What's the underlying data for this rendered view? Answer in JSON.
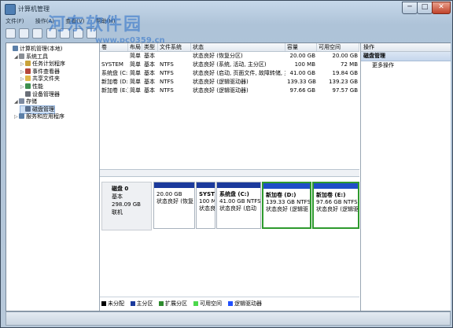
{
  "window": {
    "title": "计算机管理",
    "watermark": "河东软件园",
    "watermark_url": "www.pc0359.cn",
    "minimize": "─",
    "maximize": "□",
    "close": "✕"
  },
  "menu": [
    "文件(F)",
    "操作(A)",
    "查看(V)",
    "帮助(H)"
  ],
  "tree": [
    {
      "label": "计算机管理(本地)",
      "icon": "computer-icon",
      "indent": 0,
      "expand": ""
    },
    {
      "label": "系统工具",
      "icon": "tools-icon",
      "indent": 1,
      "expand": "◢"
    },
    {
      "label": "任务计划程序",
      "icon": "clock-icon",
      "indent": 2,
      "expand": "▷"
    },
    {
      "label": "事件查看器",
      "icon": "event-icon",
      "indent": 2,
      "expand": "▷"
    },
    {
      "label": "共享文件夹",
      "icon": "folder-icon",
      "indent": 2,
      "expand": "▷"
    },
    {
      "label": "性能",
      "icon": "performance-icon",
      "indent": 2,
      "expand": "▷"
    },
    {
      "label": "设备管理器",
      "icon": "device-icon",
      "indent": 2,
      "expand": ""
    },
    {
      "label": "存储",
      "icon": "storage-icon",
      "indent": 1,
      "expand": "◢"
    },
    {
      "label": "磁盘管理",
      "icon": "disk-icon",
      "indent": 2,
      "expand": ""
    },
    {
      "label": "服务和应用程序",
      "icon": "services-icon",
      "indent": 1,
      "expand": "▷"
    }
  ],
  "volumes": {
    "headers": [
      "卷",
      "布局",
      "类型",
      "文件系统",
      "状态",
      "容量",
      "可用空间"
    ],
    "rows": [
      {
        "name": "",
        "layout": "简单",
        "type": "基本",
        "fs": "",
        "status": "状态良好 (恢复分区)",
        "capacity": "20.00 GB",
        "free": "20.00 GB"
      },
      {
        "name": "SYSTEM",
        "layout": "简单",
        "type": "基本",
        "fs": "NTFS",
        "status": "状态良好 (系统, 活动, 主分区)",
        "capacity": "100 MB",
        "free": "72 MB"
      },
      {
        "name": "系统盘 (C:)",
        "layout": "简单",
        "type": "基本",
        "fs": "NTFS",
        "status": "状态良好 (启动, 页面文件, 故障转储, 主分区)",
        "capacity": "41.00 GB",
        "free": "19.84 GB"
      },
      {
        "name": "新加卷 (D:)",
        "layout": "简单",
        "type": "基本",
        "fs": "NTFS",
        "status": "状态良好 (逻辑驱动器)",
        "capacity": "139.33 GB",
        "free": "139.23 GB"
      },
      {
        "name": "新加卷 (E:)",
        "layout": "简单",
        "type": "基本",
        "fs": "NTFS",
        "status": "状态良好 (逻辑驱动器)",
        "capacity": "97.66 GB",
        "free": "97.57 GB"
      }
    ]
  },
  "disk": {
    "name": "磁盘 0",
    "type": "基本",
    "size": "298.09 GB",
    "state": "联机",
    "partitions": [
      {
        "name": "",
        "size": "20.00 GB",
        "status": "状态良好 (恢复",
        "kind": "primary"
      },
      {
        "name": "SYST",
        "size": "100 M",
        "status": "状态良",
        "kind": "primary"
      },
      {
        "name": "系统盘 (C:)",
        "size": "41.00 GB NTFS",
        "status": "状态良好 (启动",
        "kind": "primary"
      },
      {
        "name": "新加卷 (D:)",
        "size": "139.33 GB NTFS",
        "status": "状态良好 (逻辑驱",
        "kind": "logical"
      },
      {
        "name": "新加卷 (E:)",
        "size": "97.66 GB NTFS",
        "status": "状态良好 (逻辑驱",
        "kind": "logical"
      }
    ]
  },
  "legend": [
    {
      "label": "未分配",
      "color": "#000000"
    },
    {
      "label": "主分区",
      "color": "#1b3a9c"
    },
    {
      "label": "扩展分区",
      "color": "#2e8b2e"
    },
    {
      "label": "可用空间",
      "color": "#4cd84c"
    },
    {
      "label": "逻辑驱动器",
      "color": "#2050ff"
    }
  ],
  "actions": {
    "header": "操作",
    "section": "磁盘管理",
    "more": "更多操作"
  }
}
